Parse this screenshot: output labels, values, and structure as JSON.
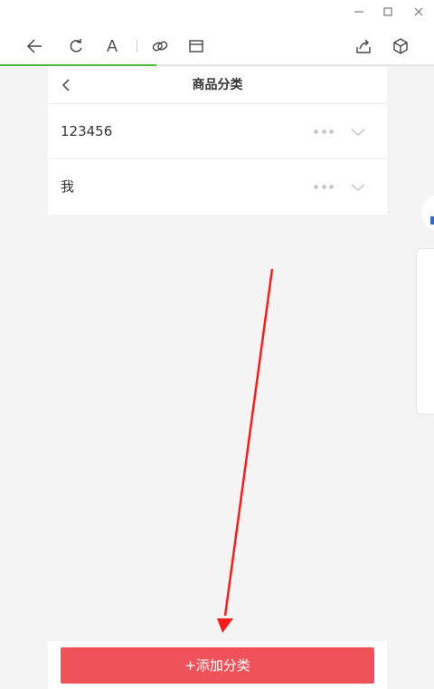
{
  "window": {
    "minimize_icon": "minimize-icon",
    "maximize_icon": "maximize-icon",
    "close_icon": "close-icon"
  },
  "toolbar": {
    "icons": [
      "back-arrow-icon",
      "refresh-icon",
      "font-icon",
      "link-icon",
      "window-icon",
      "share-icon",
      "cube-icon"
    ],
    "font_glyph": "A",
    "loading_progress": 0.36,
    "progress_color": "#4cbb3f"
  },
  "nav": {
    "title": "商品分类"
  },
  "categories": [
    {
      "name": "123456"
    },
    {
      "name": "我"
    }
  ],
  "footer": {
    "add_button_label": "+添加分类",
    "add_button_color": "#f0525a"
  },
  "annotation": {
    "arrow_color": "#ff1a1a"
  }
}
